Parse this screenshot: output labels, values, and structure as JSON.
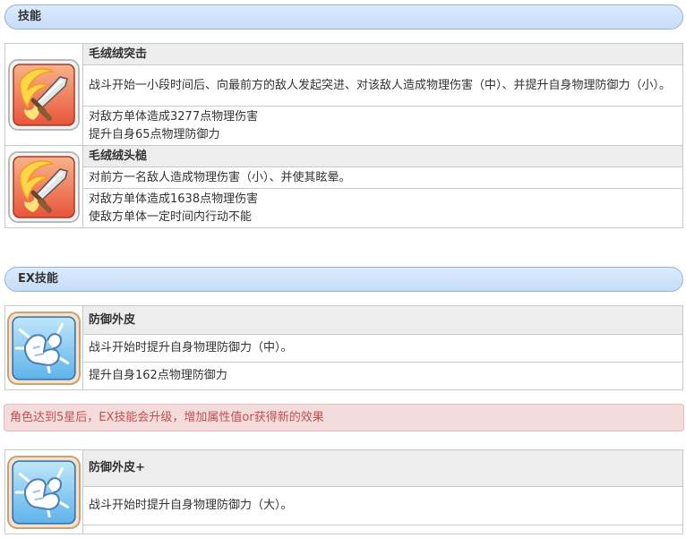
{
  "skills_section": {
    "title": "技能",
    "skills": [
      {
        "name": "毛绒绒突击",
        "description": "战斗开始一小段时间后、向最前方的敌人发起突进、对该敌人造成物理伤害（中）、并提升自身物理防御力（小）。",
        "effects": [
          "对敌方单体造成3277点物理伤害",
          "提升自身65点物理防御力"
        ],
        "icon": "sword-slash-icon"
      },
      {
        "name": "毛绒绒头槌",
        "description": "对前方一名敌人造成物理伤害（小）、并使其眩晕。",
        "effects": [
          "对敌方单体造成1638点物理伤害",
          "使敌方单体一定时间内行动不能"
        ],
        "icon": "sword-slash-icon"
      }
    ]
  },
  "ex_section": {
    "title": "EX技能",
    "skill": {
      "name": "防御外皮",
      "description": "战斗开始时提升自身物理防御力（中）。",
      "effects": [
        "提升自身162点物理防御力"
      ],
      "icon": "shield-arm-icon"
    },
    "notice": "角色达到5星后，EX技能会升级，增加属性值or获得新的效果",
    "upgraded_skill": {
      "name": "防御外皮+",
      "description": "战斗开始时提升自身物理防御力（大）。",
      "icon": "shield-arm-icon"
    }
  }
}
